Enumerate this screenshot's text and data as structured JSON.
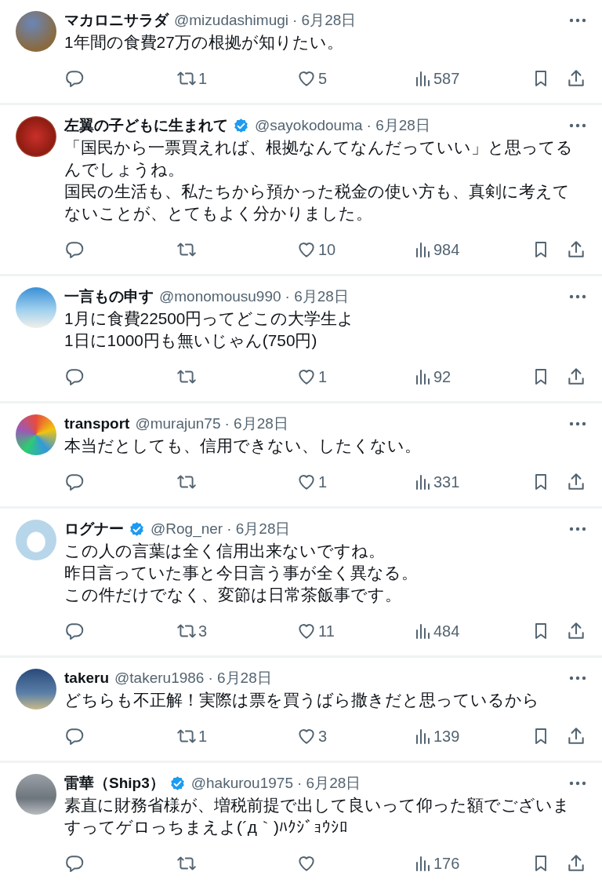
{
  "tweets": [
    {
      "name": "マカロニサラダ",
      "verified": false,
      "handle": "@mizudashimugi",
      "date": "· 6月28日",
      "lines": [
        "1年間の食費27万の根拠が知りたい。"
      ],
      "reposts": "1",
      "likes": "5",
      "views": "587"
    },
    {
      "name": "左翼の子どもに生まれて",
      "verified": true,
      "handle": "@sayokodouma",
      "date": "· 6月28日",
      "lines": [
        "「国民から一票買えれば、根拠なんてなんだっていい」と思ってるんでしょうね。",
        "国民の生活も、私たちから預かった税金の使い方も、真剣に考えてないことが、とてもよく分かりました。"
      ],
      "likes": "10",
      "views": "984"
    },
    {
      "name": "一言もの申す",
      "verified": false,
      "handle": "@monomousu990",
      "date": "· 6月28日",
      "lines": [
        "1月に食費22500円ってどこの大学生よ",
        "1日に1000円も無いじゃん(750円)"
      ],
      "likes": "1",
      "views": "92"
    },
    {
      "name": "transport",
      "verified": false,
      "handle": "@murajun75",
      "date": "· 6月28日",
      "lines": [
        "本当だとしても、信用できない、したくない。"
      ],
      "likes": "1",
      "views": "331"
    },
    {
      "name": "ログナー",
      "verified": true,
      "handle": "@Rog_ner",
      "date": "· 6月28日",
      "lines": [
        "この人の言葉は全く信用出来ないですね。",
        "昨日言っていた事と今日言う事が全く異なる。",
        "この件だけでなく、変節は日常茶飯事です。"
      ],
      "reposts": "3",
      "likes": "11",
      "views": "484"
    },
    {
      "name": "takeru",
      "verified": false,
      "handle": "@takeru1986",
      "date": "· 6月28日",
      "lines": [
        "どちらも不正解！実際は票を買うばら撒きだと思っているから"
      ],
      "reposts": "1",
      "likes": "3",
      "views": "139"
    },
    {
      "name": "雷華（Ship3）",
      "verified": true,
      "handle": "@hakurou1975",
      "date": "· 6月28日",
      "lines": [
        "素直に財務省様が、増税前提で出して良いって仰った額でございますってゲロっちまえよ(´д｀)ﾊｸｼﾞｮｳｼﾛ"
      ],
      "views": "176"
    }
  ]
}
